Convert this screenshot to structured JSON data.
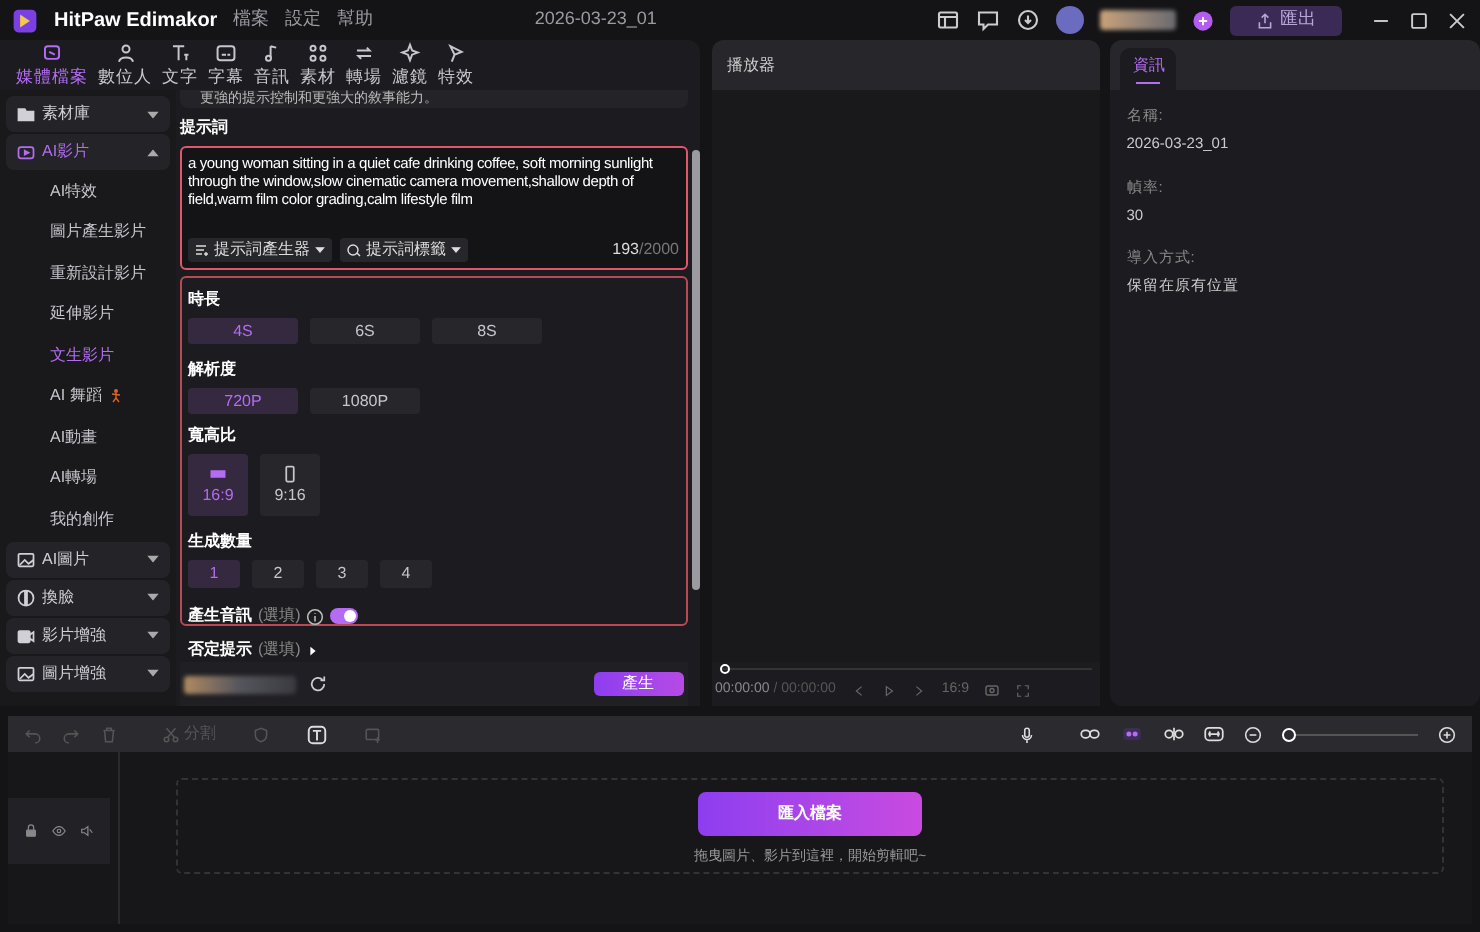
{
  "window": {
    "app_name": "HitPaw Edimakor",
    "menu": [
      "檔案",
      "設定",
      "幫助"
    ],
    "project_title": "2026-03-23_01",
    "export_button": "匯出"
  },
  "toolbar_tabs": [
    {
      "label": "媒體檔案",
      "selected": true
    },
    {
      "label": "數位人",
      "selected": false
    },
    {
      "label": "文字",
      "selected": false
    },
    {
      "label": "字幕",
      "selected": false
    },
    {
      "label": "音訊",
      "selected": false
    },
    {
      "label": "素材",
      "selected": false
    },
    {
      "label": "轉場",
      "selected": false
    },
    {
      "label": "濾鏡",
      "selected": false
    },
    {
      "label": "特效",
      "selected": false
    }
  ],
  "sidebar": {
    "groups": [
      {
        "label": "素材庫",
        "expanded": false,
        "selected": false
      },
      {
        "label": "AI影片",
        "expanded": true,
        "selected": true,
        "children": [
          {
            "label": "AI特效",
            "selected": false
          },
          {
            "label": "圖片產生影片",
            "selected": false
          },
          {
            "label": "重新設計影片",
            "selected": false
          },
          {
            "label": "延伸影片",
            "selected": false
          },
          {
            "label": "文生影片",
            "selected": true
          },
          {
            "label": "AI 舞蹈",
            "selected": false
          },
          {
            "label": "AI動畫",
            "selected": false
          },
          {
            "label": "AI轉場",
            "selected": false
          },
          {
            "label": "我的創作",
            "selected": false
          }
        ]
      },
      {
        "label": "AI圖片",
        "expanded": false,
        "selected": false
      },
      {
        "label": "換臉",
        "expanded": false,
        "selected": false
      },
      {
        "label": "影片增強",
        "expanded": false,
        "selected": false
      },
      {
        "label": "圖片增強",
        "expanded": false,
        "selected": false
      }
    ]
  },
  "form": {
    "intro": "更強的提示控制和更強大的敘事能力。",
    "prompt_label": "提示詞",
    "prompt": "a young woman sitting in a quiet cafe drinking coffee, soft morning sunlight through the window,slow cinematic camera movement,shallow depth of field,warm film color grading,calm lifestyle film",
    "prompt_tools": [
      "提示詞產生器",
      "提示詞標籤"
    ],
    "count_used": "193",
    "count_max": "/2000",
    "duration": {
      "label": "時長",
      "options": [
        {
          "label": "4S",
          "selected": true
        },
        {
          "label": "6S",
          "selected": false
        },
        {
          "label": "8S",
          "selected": false
        }
      ]
    },
    "resolution": {
      "label": "解析度",
      "options": [
        {
          "label": "720P",
          "selected": true
        },
        {
          "label": "1080P",
          "selected": false
        }
      ]
    },
    "aspect_ratio": {
      "label": "寬高比",
      "options": [
        {
          "label": "16:9",
          "kind": "landscape",
          "selected": true
        },
        {
          "label": "9:16",
          "kind": "portrait",
          "selected": false
        }
      ]
    },
    "quantity": {
      "label": "生成數量",
      "options": [
        {
          "label": "1",
          "selected": true
        },
        {
          "label": "2",
          "selected": false
        },
        {
          "label": "3",
          "selected": false
        },
        {
          "label": "4",
          "selected": false
        }
      ]
    },
    "audio": {
      "label": "產生音訊",
      "hint": "(選填)",
      "on": true
    },
    "negative_prompt": {
      "label": "否定提示",
      "hint": "(選填)",
      "expanded": false
    },
    "generate_button": "產生"
  },
  "player": {
    "title": "播放器",
    "position": {
      "level": 0
    },
    "current_time": "00:00:00",
    "total_time": "/ 00:00:00",
    "ratio": "16:9"
  },
  "info": {
    "tab": "資訊",
    "fields": [
      {
        "label": "名稱:",
        "value": "2026-03-23_01"
      },
      {
        "label": "幀率:",
        "value": "30"
      },
      {
        "label": "導入方式:",
        "value": "保留在原有位置"
      }
    ]
  },
  "timeline": {
    "zoom": {
      "level": 0
    },
    "split_label": "分割",
    "import_button": "匯入檔案",
    "drop_hint": "拖曳圖片、影片到這裡，開始剪輯吧~"
  }
}
